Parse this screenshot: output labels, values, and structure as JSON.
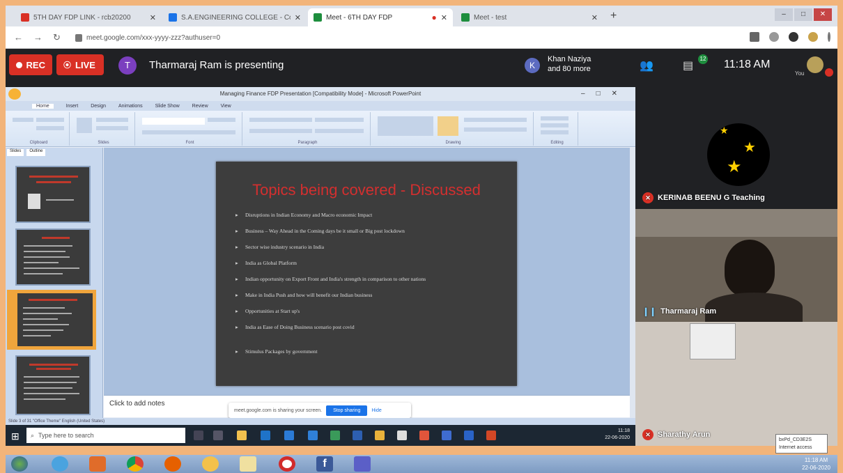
{
  "browser": {
    "tabs": [
      {
        "title": "5TH DAY FDP LINK - rcb20200",
        "favicon_color": "#d93025"
      },
      {
        "title": "S.A.ENGINEERING COLLEGE - Co",
        "favicon_color": "#1a73e8"
      },
      {
        "title": "Meet - 6TH DAY FDP",
        "favicon_color": "#1e8e3e"
      },
      {
        "title": "Meet - test",
        "favicon_color": "#1e8e3e"
      }
    ],
    "url": "meet.google.com/xxx-yyyy-zzz?authuser=0"
  },
  "meet": {
    "rec_label": "REC",
    "live_label": "LIVE",
    "presenter_initial": "T",
    "presenting_text": "Tharmaraj Ram is presenting",
    "participants_initial": "K",
    "participants_line1": "Khan Naziya",
    "participants_line2": "and 80 more",
    "chat_count": "12",
    "clock": "11:18 AM",
    "you_label": "You",
    "accent": "#d93025"
  },
  "ppt": {
    "window_title": "Managing Finance FDP Presentation [Compatibility Mode] - Microsoft PowerPoint",
    "ribbon_tabs": [
      "Home",
      "Insert",
      "Design",
      "Animations",
      "Slide Show",
      "Review",
      "View"
    ],
    "ribbon_groups": [
      "Clipboard",
      "Slides",
      "Font",
      "Paragraph",
      "Drawing",
      "Editing"
    ],
    "panel_tabs": [
      "Slides",
      "Outline"
    ],
    "slide_title": "Topics being covered - Discussed",
    "bullets": [
      "Disruptions in Indian Economy and Macro economic Impact",
      "Business – Way Ahead in the Coming days be it small or Big post lockdown",
      "Sector wise industry scenario in India",
      "India as Global Platform",
      "Indian opportunity on Export Front and India's strength in comparison to other nations",
      "Make in India Push and how will benefit our Indian business",
      "Opportunities at Start up's",
      "India as Ease of Doing Business scenario post covid",
      "Stimulus Packages by government"
    ],
    "notes_placeholder": "Click to add notes",
    "share_notice": "meet.google.com is sharing your screen.",
    "stop_sharing": "Stop sharing",
    "hide": "Hide",
    "status": "Slide 3 of 31    \"Office Theme\"    English (United States)",
    "search_placeholder": "Type here to search",
    "tray_line1": "11:18",
    "tray_line2": "22-06-2020"
  },
  "participants": [
    {
      "name": "KERINAB BEENU G Teaching",
      "muted": true
    },
    {
      "name": "Tharmaraj Ram",
      "muted": false
    },
    {
      "name": "Sharathy Arun",
      "muted": true
    }
  ],
  "tooltip": {
    "line1": "bxPd_CD3E2S",
    "line2": "Internet access"
  },
  "w7": {
    "clock_line1": "11:18 AM",
    "clock_line2": "22-06-2020"
  }
}
